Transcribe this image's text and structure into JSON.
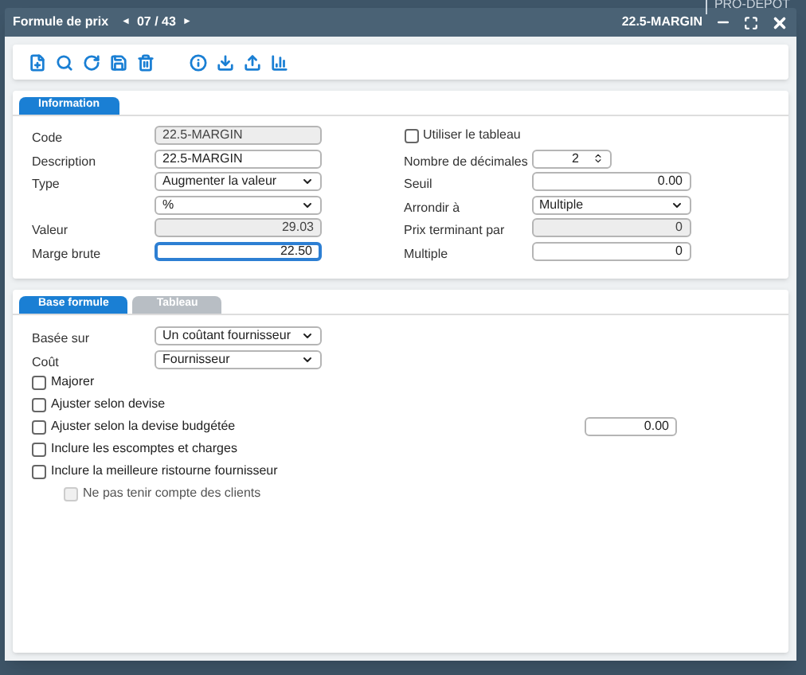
{
  "background": {
    "brand": "PRO-DEPOT"
  },
  "window": {
    "title": "Formule de prix",
    "nav_prev": "◄",
    "record": "07 / 43",
    "nav_next": "►",
    "record_name": "22.5-MARGIN"
  },
  "info_tabs": [
    {
      "label": "Information",
      "selected": true
    }
  ],
  "info_left": [
    {
      "label": "Code",
      "kind": "text",
      "value": "22.5-MARGIN",
      "disabled": true,
      "focused": false
    },
    {
      "label": "Description",
      "kind": "text",
      "value": "22.5-MARGIN",
      "disabled": false,
      "focused": false
    },
    {
      "label": "Type",
      "kind": "select",
      "value": "Augmenter la valeur",
      "disabled": false,
      "focused": false
    },
    {
      "kind": "select",
      "value": "%",
      "disabled": false,
      "focused": false
    },
    {
      "label": "Valeur",
      "kind": "number",
      "value": "29.03",
      "disabled": true,
      "focused": false
    },
    {
      "label": "Marge brute",
      "kind": "number",
      "value": "22.50",
      "disabled": false,
      "focused": true
    }
  ],
  "info_right": [
    {
      "label": "Utiliser le tableau",
      "kind": "checkbox",
      "checked": false
    },
    {
      "label": "Nombre de décimales",
      "kind": "spinner",
      "value": "2",
      "disabled": false
    },
    {
      "label": "Seuil",
      "kind": "number",
      "value": "0.00",
      "disabled": false
    },
    {
      "label": "Arrondir à",
      "kind": "select",
      "value": "Multiple",
      "disabled": false
    },
    {
      "label": "Prix terminant par",
      "kind": "number",
      "value": "0",
      "disabled": true
    },
    {
      "label": "Multiple",
      "kind": "number",
      "value": "0",
      "disabled": false
    }
  ],
  "base_tabs": [
    {
      "label": "Base formule",
      "selected": true
    },
    {
      "label": "Tableau",
      "selected": false
    }
  ],
  "base_fields": [
    {
      "label": "Basée sur",
      "value": "Un coûtant fournisseur"
    },
    {
      "label": "Coût",
      "value": "Fournisseur"
    }
  ],
  "base_options": [
    {
      "label": "Majorer",
      "checked": false,
      "disabled": false
    },
    {
      "label": "Ajuster selon devise",
      "checked": false,
      "disabled": false
    },
    {
      "label": "Ajuster selon la devise budgétée",
      "checked": false,
      "disabled": false,
      "value": "0.00"
    },
    {
      "label": "Inclure les escomptes et charges",
      "checked": false,
      "disabled": false
    },
    {
      "label": "Inclure la meilleure ristourne fournisseur",
      "checked": false,
      "disabled": false,
      "children": [
        {
          "label": "Ne pas tenir compte des clients",
          "checked": false,
          "disabled": true
        }
      ]
    }
  ]
}
